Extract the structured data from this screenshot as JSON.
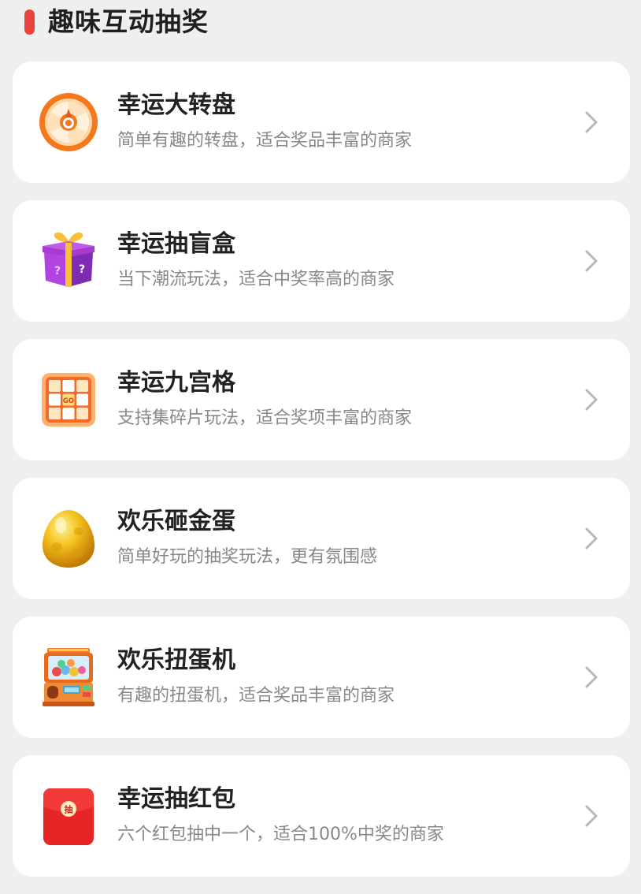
{
  "section": {
    "title": "趣味互动抽奖",
    "accent_color": "#e8443a"
  },
  "cards": [
    {
      "title": "幸运大转盘",
      "desc": "简单有趣的转盘，适合奖品丰富的商家",
      "icon": "wheel-icon"
    },
    {
      "title": "幸运抽盲盒",
      "desc": "当下潮流玩法，适合中奖率高的商家",
      "icon": "mystery-box-icon"
    },
    {
      "title": "幸运九宫格",
      "desc": "支持集碎片玩法，适合奖项丰富的商家",
      "icon": "nine-grid-icon",
      "icon_text": "GO"
    },
    {
      "title": "欢乐砸金蛋",
      "desc": "简单好玩的抽奖玩法，更有氛围感",
      "icon": "golden-egg-icon"
    },
    {
      "title": "欢乐扭蛋机",
      "desc": "有趣的扭蛋机，适合奖品丰富的商家",
      "icon": "gashapon-machine-icon"
    },
    {
      "title": "幸运抽红包",
      "desc": "六个红包抽中一个，适合100%中奖的商家",
      "icon": "red-envelope-icon",
      "icon_text": "抽"
    }
  ]
}
